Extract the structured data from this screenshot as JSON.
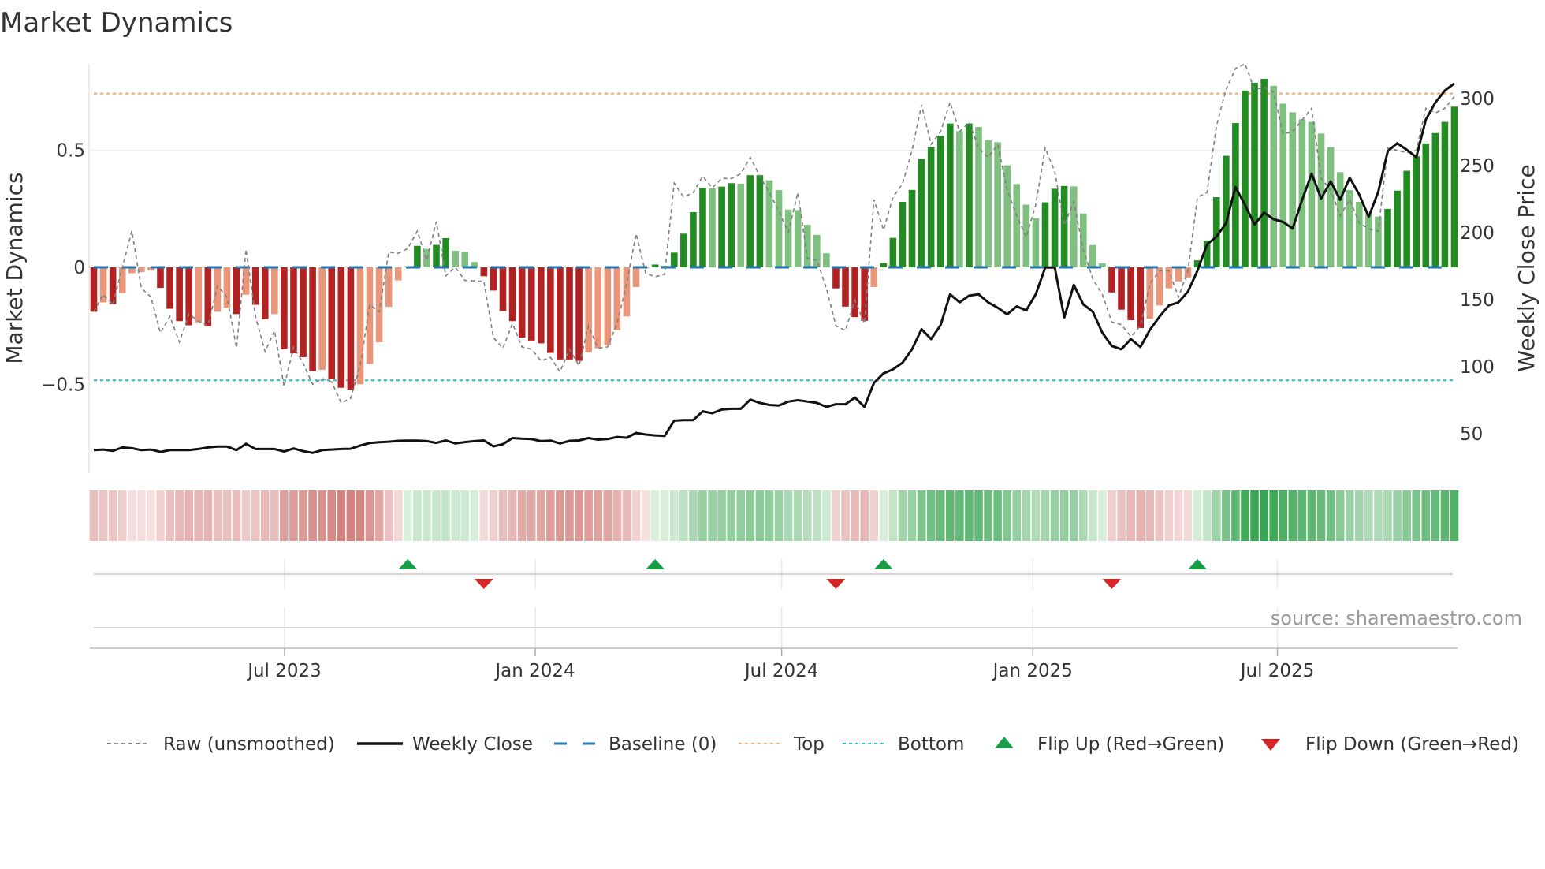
{
  "title": "Market Dynamics",
  "source": "source: sharemaestro.com",
  "colors": {
    "pos_rising": "#228b22",
    "pos_falling": "#7fbf7f",
    "neg_rising": "#b22222",
    "neg_falling": "#e9967a",
    "baseline": "#1f77b4",
    "top": "#f4a460",
    "bottom": "#17becf",
    "raw": "#808080",
    "close": "#111111",
    "flip_up": "#1a9c47",
    "flip_down": "#d62728"
  },
  "legend": [
    {
      "label": "Raw (unsmoothed)",
      "kind": "raw"
    },
    {
      "label": "Weekly Close",
      "kind": "close"
    },
    {
      "label": "Baseline (0)",
      "kind": "baseline"
    },
    {
      "label": "Top",
      "kind": "top"
    },
    {
      "label": "Bottom",
      "kind": "bottom"
    },
    {
      "label": "Flip Up (Red→Green)",
      "kind": "flip_up"
    },
    {
      "label": "Flip Down (Green→Red)",
      "kind": "flip_down"
    }
  ],
  "chart_data": {
    "type": "bar+line",
    "title": "Market Dynamics",
    "n_weeks": 144,
    "x_ticks": [
      {
        "label": "Jul 2023",
        "week": 20.05
      },
      {
        "label": "Jan 2024",
        "week": 46.4
      },
      {
        "label": "Jul 2024",
        "week": 72.3
      },
      {
        "label": "Jan 2025",
        "week": 98.7
      },
      {
        "label": "Jul 2025",
        "week": 124.4
      }
    ],
    "left_axis": {
      "label": "Market Dynamics",
      "ylim": [
        -0.88,
        0.87
      ],
      "ticks": [
        {
          "v": 0.5,
          "label": "0.5"
        },
        {
          "v": 0,
          "label": "0"
        },
        {
          "v": -0.5,
          "label": "−0.5"
        }
      ]
    },
    "right_axis": {
      "label": "Weekly Close Price",
      "ylim": [
        20.6,
        325.9
      ],
      "ticks": [
        {
          "v": 50,
          "label": "50"
        },
        {
          "v": 100,
          "label": "100"
        },
        {
          "v": 150,
          "label": "150"
        },
        {
          "v": 200,
          "label": "200"
        },
        {
          "v": 250,
          "label": "250"
        },
        {
          "v": 300,
          "label": "300"
        }
      ]
    },
    "reference_lines": {
      "baseline": 0,
      "top": 0.743,
      "bottom": -0.483
    },
    "smoothed": [
      -0.19,
      -0.15,
      -0.157,
      -0.11,
      -0.025,
      -0.02,
      -0.014,
      -0.088,
      -0.177,
      -0.23,
      -0.248,
      -0.235,
      -0.252,
      -0.19,
      -0.172,
      -0.2,
      -0.117,
      -0.16,
      -0.222,
      -0.2,
      -0.35,
      -0.368,
      -0.384,
      -0.444,
      -0.438,
      -0.477,
      -0.515,
      -0.523,
      -0.5,
      -0.413,
      -0.32,
      -0.169,
      -0.056,
      0.004,
      0.092,
      0.079,
      0.096,
      0.125,
      0.071,
      0.066,
      0.023,
      -0.038,
      -0.099,
      -0.187,
      -0.23,
      -0.3,
      -0.313,
      -0.325,
      -0.366,
      -0.394,
      -0.394,
      -0.4,
      -0.364,
      -0.346,
      -0.332,
      -0.268,
      -0.21,
      -0.084,
      -0.004,
      0.012,
      0.007,
      0.063,
      0.144,
      0.236,
      0.34,
      0.338,
      0.345,
      0.36,
      0.358,
      0.394,
      0.394,
      0.372,
      0.33,
      0.247,
      0.245,
      0.182,
      0.139,
      0.06,
      -0.09,
      -0.168,
      -0.213,
      -0.229,
      -0.084,
      0.018,
      0.126,
      0.28,
      0.331,
      0.464,
      0.515,
      0.562,
      0.615,
      0.582,
      0.615,
      0.6,
      0.543,
      0.535,
      0.436,
      0.356,
      0.268,
      0.21,
      0.278,
      0.336,
      0.348,
      0.346,
      0.23,
      0.095,
      0.017,
      -0.107,
      -0.181,
      -0.226,
      -0.26,
      -0.22,
      -0.163,
      -0.09,
      -0.06,
      -0.043,
      0.03,
      0.115,
      0.3,
      0.477,
      0.617,
      0.756,
      0.789,
      0.806,
      0.776,
      0.7,
      0.663,
      0.633,
      0.622,
      0.572,
      0.514,
      0.407,
      0.33,
      0.28,
      0.229,
      0.217,
      0.25,
      0.328,
      0.413,
      0.475,
      0.53,
      0.574,
      0.622,
      0.687
    ],
    "raw": [
      -0.19,
      -0.115,
      -0.16,
      0,
      0.155,
      -0.09,
      -0.126,
      -0.28,
      -0.21,
      -0.32,
      -0.2,
      -0.23,
      -0.25,
      -0.08,
      -0.126,
      -0.345,
      0.077,
      -0.21,
      -0.36,
      -0.27,
      -0.51,
      -0.34,
      -0.41,
      -0.5,
      -0.475,
      -0.49,
      -0.58,
      -0.56,
      -0.42,
      -0.16,
      -0.19,
      0.065,
      0.06,
      0.08,
      0.155,
      0.03,
      0.195,
      -0.036,
      0,
      -0.056,
      -0.058,
      -0.06,
      -0.3,
      -0.346,
      -0.24,
      -0.34,
      -0.35,
      -0.4,
      -0.385,
      -0.447,
      -0.35,
      -0.42,
      -0.25,
      -0.346,
      -0.34,
      -0.24,
      -0.07,
      0.144,
      -0.025,
      -0.04,
      -0.03,
      0.36,
      0.3,
      0.32,
      0.39,
      0.34,
      0.38,
      0.38,
      0.4,
      0.47,
      0.39,
      0.32,
      0.24,
      0.15,
      0.32,
      0.04,
      0.03,
      -0.09,
      -0.25,
      -0.27,
      -0.14,
      -0.24,
      0.29,
      0.16,
      0.3,
      0.357,
      0.5,
      0.695,
      0.526,
      0.58,
      0.706,
      0.58,
      0.62,
      0.51,
      0.47,
      0.526,
      0.33,
      0.22,
      0.13,
      0.267,
      0.51,
      0.41,
      0.18,
      0.28,
      0.075,
      -0.05,
      -0.116,
      -0.234,
      -0.245,
      -0.296,
      -0.25,
      -0.07,
      -0.015,
      -0.015,
      -0.127,
      -0.015,
      0.3,
      0.32,
      0.605,
      0.76,
      0.85,
      0.87,
      0.76,
      0.77,
      0.75,
      0.57,
      0.58,
      0.63,
      0.68,
      0.38,
      0.33,
      0.22,
      0.29,
      0.19,
      0.165,
      0.154,
      0.51,
      0.5,
      0.49,
      0.5,
      0.68,
      0.66,
      0.68,
      0.73
    ],
    "weekly_close": [
      37.8,
      38.2,
      37.2,
      39.8,
      39.2,
      37.8,
      38.2,
      36.4,
      37.8,
      37.8,
      37.8,
      38.6,
      39.8,
      40.4,
      40.4,
      37.8,
      42.5,
      38.6,
      38.6,
      38.6,
      36.7,
      39,
      37,
      35.7,
      37.8,
      38.2,
      38.6,
      38.8,
      41.2,
      43.1,
      43.7,
      44.1,
      44.7,
      44.9,
      44.9,
      44.5,
      43.2,
      45,
      42.8,
      43.8,
      44.5,
      45,
      40.6,
      42.2,
      46.8,
      46.3,
      46,
      44.5,
      44.9,
      42.8,
      44.7,
      45,
      46.8,
      45.6,
      46,
      47.6,
      47,
      50.6,
      49.4,
      48.8,
      48.4,
      59.8,
      60.2,
      60.2,
      66.7,
      65.3,
      68,
      68.6,
      68.6,
      75.5,
      73,
      71.5,
      71,
      74,
      75,
      74,
      73,
      70,
      72,
      72,
      77,
      70,
      88,
      95,
      98,
      103,
      113,
      128,
      120.6,
      131,
      154,
      148,
      153,
      154,
      148,
      144,
      139,
      145,
      142,
      154,
      174,
      174,
      136.7,
      161,
      146.5,
      141,
      125.3,
      115.5,
      113,
      120.6,
      114.7,
      127.5,
      137.3,
      145.7,
      148,
      156,
      171.6,
      191.2,
      197,
      207,
      234,
      220.6,
      206,
      214.9,
      210,
      208,
      203,
      224.5,
      244,
      225.5,
      238.2,
      224.5,
      241,
      228.4,
      211.8,
      230.4,
      260.8,
      266.7,
      261.8,
      256.3,
      284.3,
      297,
      306,
      311.3
    ],
    "flips": {
      "up": [
        33,
        59,
        83,
        116
      ],
      "down": [
        41,
        78,
        107
      ]
    },
    "grid": true,
    "legend_position": "bottom"
  }
}
